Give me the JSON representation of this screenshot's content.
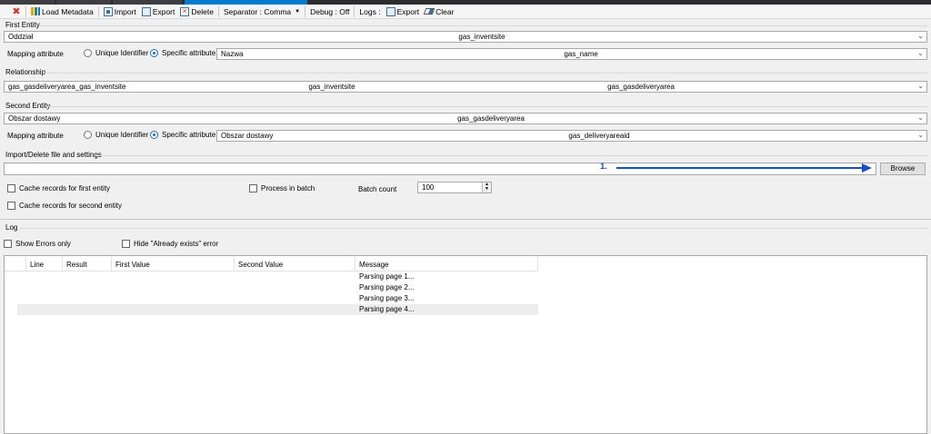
{
  "toolbar": {
    "load_metadata": "Load Metadata",
    "import": "Import",
    "export": "Export",
    "delete": "Delete",
    "separator": "Separator : Comma",
    "debug": "Debug : Off",
    "logs": "Logs :",
    "logs_export": "Export",
    "clear": "Clear"
  },
  "first_entity": {
    "label": "First Entity",
    "entity_left": "Oddział",
    "entity_name": "gas_inventsite",
    "mapping_label": "Mapping attribute",
    "opt_unique": "Unique Identifier",
    "opt_specific": "Specific attribute",
    "selected": "specific",
    "attr_left": "Nazwa",
    "attr_name": "gas_name"
  },
  "relationship": {
    "label": "Relationship",
    "rel_name": "gas_gasdeliveryarea_gas_inventsite",
    "rel_entity1": "gas_inventsite",
    "rel_entity2": "gas_gasdeliveryarea"
  },
  "second_entity": {
    "label": "Second Entity",
    "entity_left": "Obszar dostawy",
    "entity_name": "gas_gasdeliveryarea",
    "mapping_label": "Mapping attribute",
    "opt_unique": "Unique Identifier",
    "opt_specific": "Specific attribute",
    "selected": "specific",
    "attr_left": "Obszar dostawy",
    "attr_name": "gas_deliveryareaid"
  },
  "import_settings": {
    "label": "Import/Delete file and settings",
    "file_path": "",
    "annotation": "1.",
    "browse": "Browse",
    "cache_first": "Cache records for first entity",
    "cache_second": "Cache records for second entity",
    "process_batch": "Process in batch",
    "batch_count_label": "Batch count",
    "batch_count": "100"
  },
  "log": {
    "label": "Log",
    "show_errors": "Show Errors only",
    "hide_exists": "Hide \"Already exists\" error",
    "columns": [
      "Line",
      "Result",
      "First Value",
      "Second Value",
      "Message"
    ],
    "rows": [
      {
        "message": "Parsing page 1..."
      },
      {
        "message": "Parsing page 2..."
      },
      {
        "message": "Parsing page 3..."
      },
      {
        "message": "Parsing page 4..."
      }
    ]
  },
  "colors": {
    "accent": "#007acc",
    "annotation": "#1750c2",
    "radio_selected": "#1e6fc0"
  }
}
